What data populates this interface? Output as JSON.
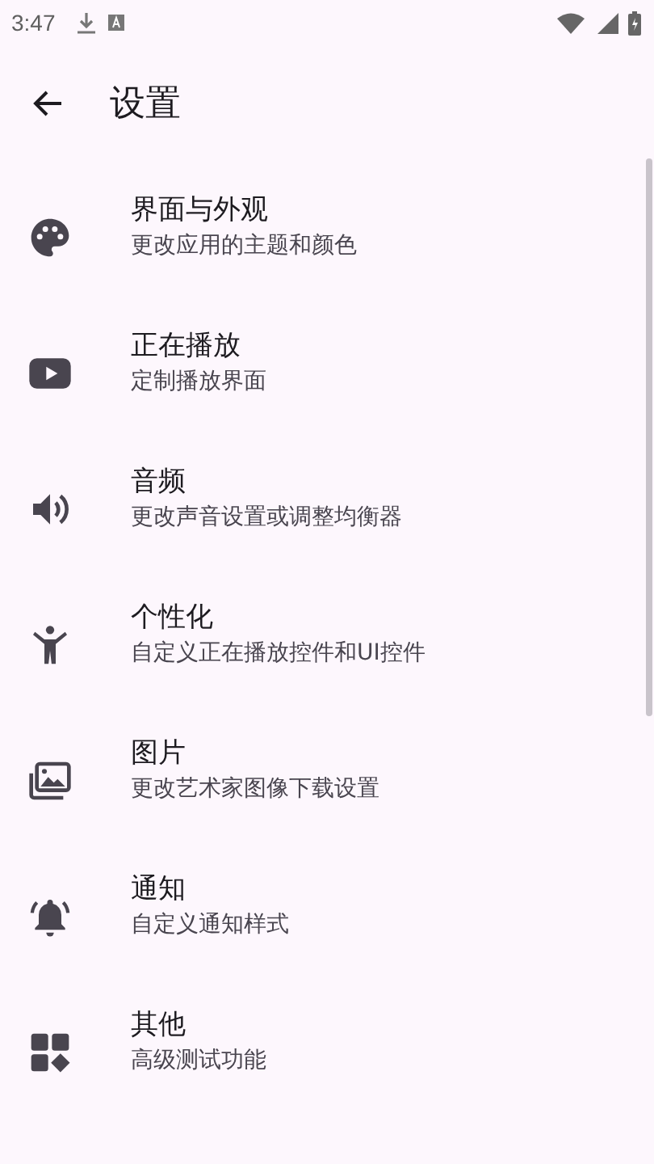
{
  "status_bar": {
    "time": "3:47"
  },
  "app_bar": {
    "title": "设置"
  },
  "items": [
    {
      "kind": "palette",
      "title": "界面与外观",
      "subtitle": "更改应用的主题和颜色"
    },
    {
      "kind": "video",
      "title": "正在播放",
      "subtitle": "定制播放界面"
    },
    {
      "kind": "volume",
      "title": "音频",
      "subtitle": "更改声音设置或调整均衡器"
    },
    {
      "kind": "person",
      "title": "个性化",
      "subtitle": "自定义正在播放控件和UI控件"
    },
    {
      "kind": "images",
      "title": "图片",
      "subtitle": "更改艺术家图像下载设置"
    },
    {
      "kind": "bell",
      "title": "通知",
      "subtitle": "自定义通知样式"
    },
    {
      "kind": "widgets",
      "title": "其他",
      "subtitle": "高级测试功能"
    }
  ]
}
